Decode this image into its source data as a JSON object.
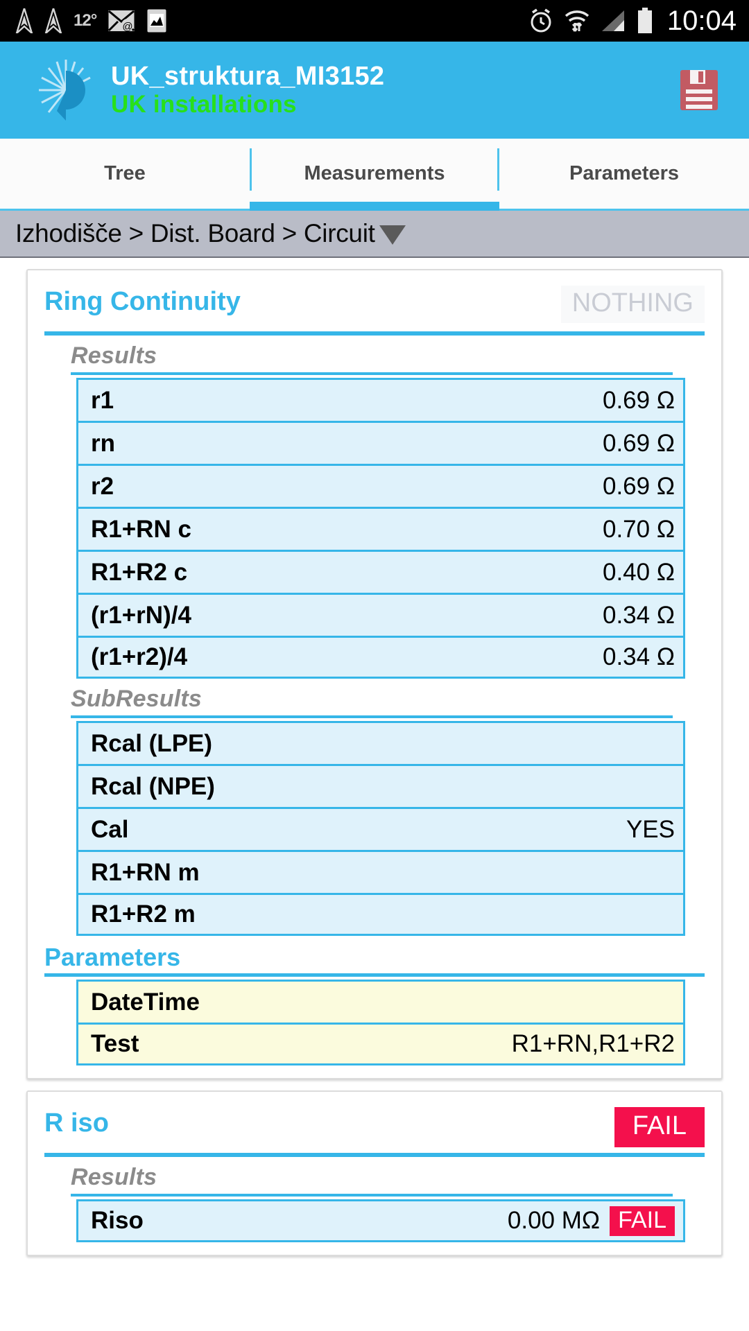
{
  "statusbar": {
    "temperature": "12°",
    "clock": "10:04",
    "icons_left": [
      "navigation-icon",
      "navigation-icon",
      "temperature-label",
      "mail-at-icon",
      "screenshot-icon"
    ],
    "icons_right": [
      "alarm-icon",
      "wifi-icon",
      "signal-icon",
      "battery-icon"
    ]
  },
  "appbar": {
    "title": "UK_struktura_MI3152",
    "subtitle": "UK installations",
    "save_icon": "save-icon",
    "logo_icon": "metrel-logo-icon"
  },
  "tabs": [
    {
      "label": "Tree",
      "active": false
    },
    {
      "label": "Measurements",
      "active": true
    },
    {
      "label": "Parameters",
      "active": false
    }
  ],
  "breadcrumb": {
    "text": "Izhodišče > Dist. Board > Circuit",
    "caret": "chevron-down-icon"
  },
  "cards": [
    {
      "title": "Ring Continuity",
      "status": "NOTHING",
      "status_kind": "nothing",
      "sections": [
        {
          "label": "Results",
          "kind": "italic",
          "rows": [
            {
              "label": "r1",
              "value": "0.69 Ω"
            },
            {
              "label": "rn",
              "value": "0.69 Ω"
            },
            {
              "label": "r2",
              "value": "0.69 Ω"
            },
            {
              "label": "R1+RN c",
              "value": "0.70 Ω"
            },
            {
              "label": "R1+R2 c",
              "value": "0.40 Ω"
            },
            {
              "label": "(r1+rN)/4",
              "value": "0.34 Ω"
            },
            {
              "label": "(r1+r2)/4",
              "value": "0.34 Ω"
            }
          ]
        },
        {
          "label": "SubResults",
          "kind": "italic",
          "rows": [
            {
              "label": "Rcal (LPE)",
              "value": ""
            },
            {
              "label": "Rcal (NPE)",
              "value": ""
            },
            {
              "label": "Cal",
              "value": "YES"
            },
            {
              "label": "R1+RN m",
              "value": ""
            },
            {
              "label": "R1+R2 m",
              "value": ""
            }
          ]
        },
        {
          "label": "Parameters",
          "kind": "blue",
          "rows": [
            {
              "label": "DateTime",
              "value": "",
              "style": "param"
            },
            {
              "label": "Test",
              "value": "R1+RN,R1+R2",
              "style": "param"
            }
          ]
        }
      ]
    },
    {
      "title": "R iso",
      "status": "FAIL",
      "status_kind": "fail",
      "sections": [
        {
          "label": "Results",
          "kind": "italic",
          "rows": [
            {
              "label": "Riso",
              "value": "0.00 MΩ",
              "flag": "FAIL"
            }
          ]
        }
      ]
    }
  ],
  "colors": {
    "accent": "#36b6e8",
    "row_bg": "#dff2fb",
    "param_bg": "#fbfbdd",
    "fail": "#f4104c",
    "green": "#28e01a",
    "breadcrumb_bg": "#b9bcc7"
  }
}
